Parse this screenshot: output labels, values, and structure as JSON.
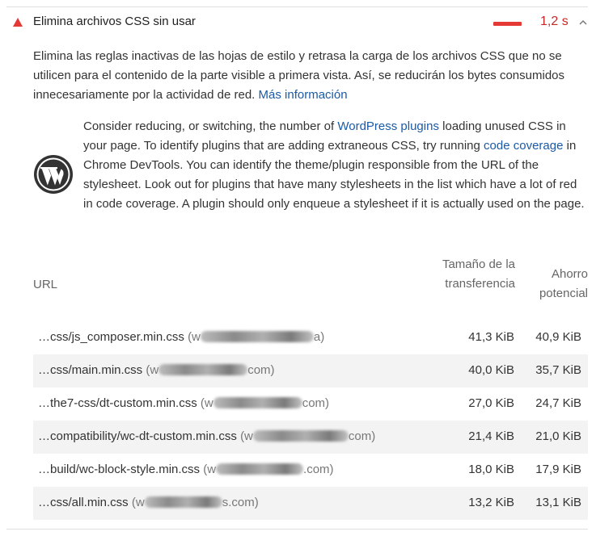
{
  "audit": {
    "title": "Elimina archivos CSS sin usar",
    "savings": "1,2 s",
    "status_color": "#e53935",
    "icons": {
      "status": "warning-triangle-icon",
      "toggle": "chevron-up-icon",
      "stack": "wordpress-logo-icon"
    }
  },
  "description": {
    "text": "Elimina las reglas inactivas de las hojas de estilo y retrasa la carga de los archivos CSS que no se utilicen para el contenido de la parte visible a primera vista. Así, se reducirán los bytes consumidos innecesariamente por la actividad de red.",
    "link": "Más información"
  },
  "stack_pack": {
    "text_1": "Consider reducing, or switching, the number of",
    "link_1": "WordPress plugins",
    "text_2": "loading unused CSS in your page. To identify plugins that are adding extraneous CSS, try running",
    "link_2": "code coverage",
    "text_3": "in Chrome DevTools. You can identify the theme/plugin responsible from the URL of the stylesheet. Look out for plugins that have many stylesheets in the list which have a lot of red in code coverage. A plugin should only enqueue a stylesheet if it is actually used on the page."
  },
  "table": {
    "headers": {
      "url": "URL",
      "transfer_size": "Tamaño de la transferencia",
      "savings": "Ahorro potencial"
    },
    "rows": [
      {
        "url": "…css/js_composer.min.css",
        "host_prefix": "(w",
        "host_suffix": "a)",
        "size": "41,3 KiB",
        "savings": "40,9 KiB"
      },
      {
        "url": "…css/main.min.css",
        "host_prefix": "(w",
        "host_suffix": "com)",
        "size": "40,0 KiB",
        "savings": "35,7 KiB"
      },
      {
        "url": "…the7-css/dt-custom.min.css",
        "host_prefix": "(w",
        "host_suffix": "com)",
        "size": "27,0 KiB",
        "savings": "24,7 KiB"
      },
      {
        "url": "…compatibility/wc-dt-custom.min.css",
        "host_prefix": "(w",
        "host_suffix": "com)",
        "size": "21,4 KiB",
        "savings": "21,0 KiB"
      },
      {
        "url": "…build/wc-block-style.min.css",
        "host_prefix": "(w",
        "host_suffix": ".com)",
        "size": "18,0 KiB",
        "savings": "17,9 KiB"
      },
      {
        "url": "…css/all.min.css",
        "host_prefix": "(w",
        "host_suffix": "s.com)",
        "size": "13,2 KiB",
        "savings": "13,1 KiB"
      }
    ]
  }
}
